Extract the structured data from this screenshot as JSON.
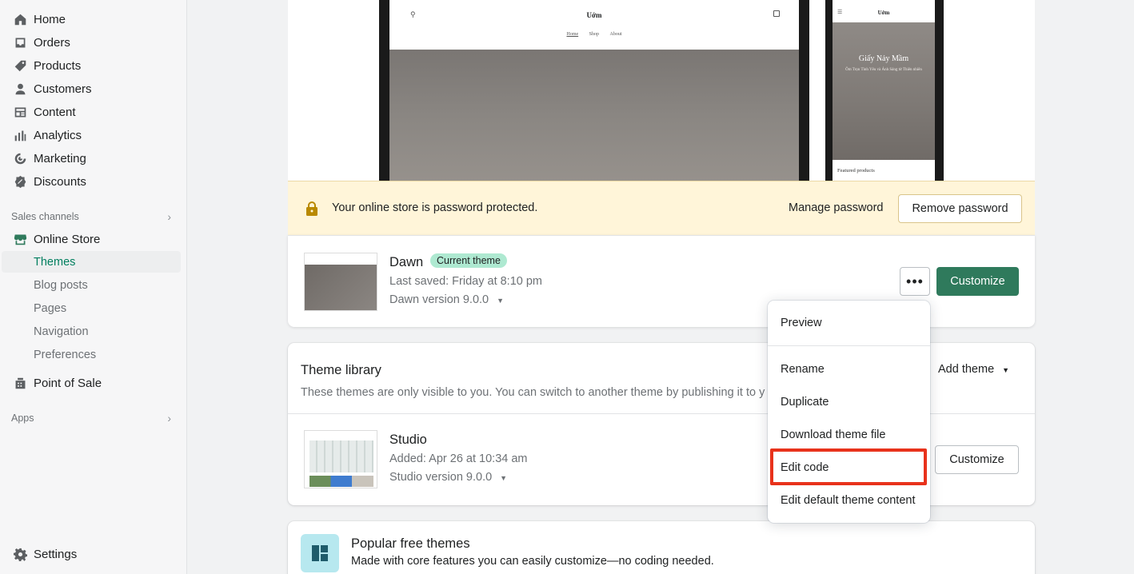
{
  "sidebar": {
    "items": [
      {
        "label": "Home",
        "icon": "home-icon"
      },
      {
        "label": "Orders",
        "icon": "orders-icon"
      },
      {
        "label": "Products",
        "icon": "tag-icon"
      },
      {
        "label": "Customers",
        "icon": "person-icon"
      },
      {
        "label": "Content",
        "icon": "content-icon"
      },
      {
        "label": "Analytics",
        "icon": "bar-chart-icon"
      },
      {
        "label": "Marketing",
        "icon": "marketing-icon"
      },
      {
        "label": "Discounts",
        "icon": "discount-icon"
      }
    ],
    "sales_channels_label": "Sales channels",
    "online_store_label": "Online Store",
    "online_store_subitems": [
      "Themes",
      "Blog posts",
      "Pages",
      "Navigation",
      "Preferences"
    ],
    "active_subitem": "Themes",
    "point_of_sale_label": "Point of Sale",
    "apps_label": "Apps",
    "settings_label": "Settings"
  },
  "preview": {
    "desktop_logo": "Uớm",
    "desktop_nav": [
      "Home",
      "Shop",
      "About"
    ],
    "mobile_logo": "Uớm",
    "mobile_hero_title": "Giấy Nảy Mầm",
    "mobile_hero_subtitle": "Ôm Trọn Tình Yêu và Ánh Sáng từ Thiên nhiên",
    "mobile_featured": "Featured products"
  },
  "password_banner": {
    "text": "Your online store is password protected.",
    "manage_label": "Manage password",
    "remove_label": "Remove password"
  },
  "current_theme": {
    "name": "Dawn",
    "badge": "Current theme",
    "last_saved": "Last saved: Friday at 8:10 pm",
    "version": "Dawn version 9.0.0",
    "customize_label": "Customize",
    "more_label": "•••"
  },
  "library": {
    "title": "Theme library",
    "description": "These themes are only visible to you. You can switch to another theme by publishing it to y",
    "add_theme_label": "Add theme",
    "themes": [
      {
        "name": "Studio",
        "added": "Added: Apr 26 at 10:34 am",
        "version": "Studio version 9.0.0",
        "customize_label": "Customize"
      }
    ]
  },
  "popular": {
    "title": "Popular free themes",
    "description": "Made with core features you can easily customize—no coding needed."
  },
  "menu": {
    "items": [
      "Preview",
      "Rename",
      "Duplicate",
      "Download theme file",
      "Edit code",
      "Edit default theme content"
    ],
    "highlighted": "Edit code"
  },
  "colors": {
    "accent": "#2f7a5c",
    "active_text": "#007f5f",
    "banner_bg": "#fff5d9",
    "highlight": "#e8321b"
  }
}
